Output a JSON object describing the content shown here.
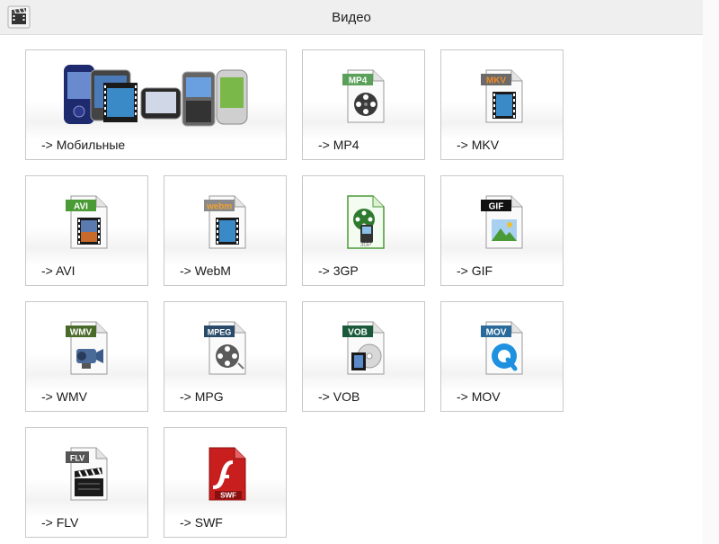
{
  "header": {
    "title": "Видео",
    "icon": "film-clapper-icon"
  },
  "colors": {
    "tile_border": "#c8c8c8",
    "header_bg": "#efefef",
    "text": "#1a1a1a"
  },
  "tiles": [
    {
      "label": "-> Мобильные",
      "icon": "mobile-phones-icon"
    },
    {
      "label": "-> MP4",
      "badge": "MP4",
      "badge_color": "#5aa05a",
      "icon": "mp4-file-icon"
    },
    {
      "label": "-> MKV",
      "badge": "MKV",
      "badge_color": "#e07a1a",
      "icon": "mkv-file-icon"
    },
    {
      "label": "-> AVI",
      "badge": "AVI",
      "badge_color": "#4a9a36",
      "icon": "avi-file-icon"
    },
    {
      "label": "-> WebM",
      "badge": "webm",
      "badge_color": "#e08a2a",
      "icon": "webm-file-icon"
    },
    {
      "label": "-> 3GP",
      "icon": "3gp-file-icon"
    },
    {
      "label": "-> GIF",
      "badge": "GIF",
      "badge_color": "#111111",
      "icon": "gif-file-icon"
    },
    {
      "label": "-> WMV",
      "badge": "WMV",
      "badge_color": "#4a6a2a",
      "icon": "wmv-file-icon"
    },
    {
      "label": "-> MPG",
      "badge": "MPEG",
      "badge_color": "#2a4a6a",
      "icon": "mpeg-file-icon"
    },
    {
      "label": "-> VOB",
      "badge": "VOB",
      "badge_color": "#1a5a3a",
      "icon": "vob-file-icon"
    },
    {
      "label": "-> MOV",
      "badge": "MOV",
      "badge_color": "#2a6a9a",
      "icon": "mov-file-icon"
    },
    {
      "label": "-> FLV",
      "badge": "FLV",
      "badge_color": "#555555",
      "icon": "flv-file-icon"
    },
    {
      "label": "-> SWF",
      "badge": "SWF",
      "badge_color": "#c81e1e",
      "icon": "swf-file-icon"
    }
  ]
}
